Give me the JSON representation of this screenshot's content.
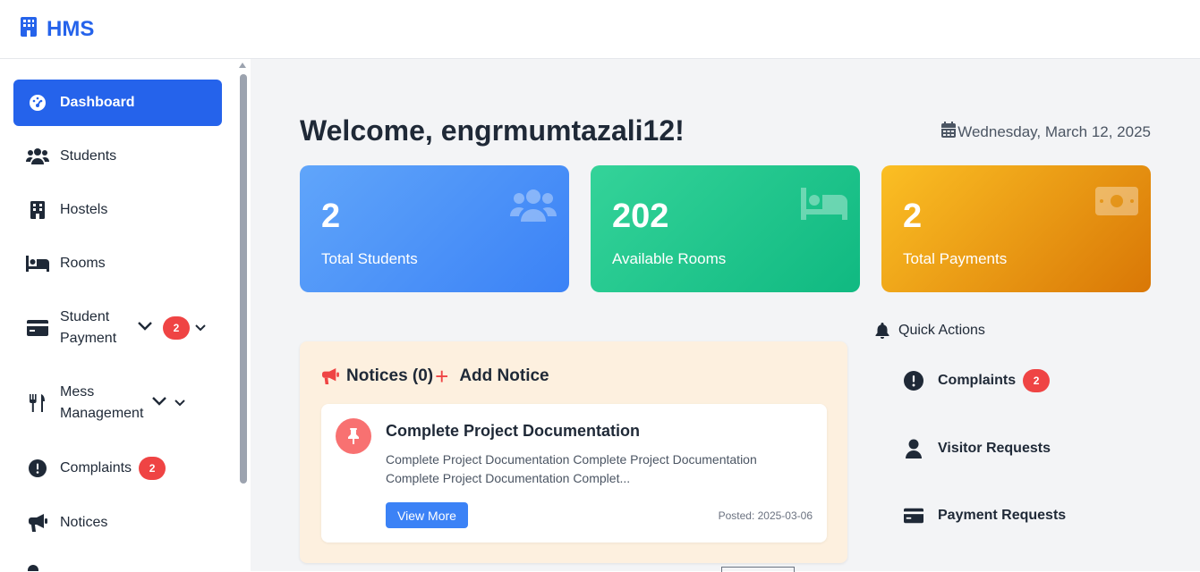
{
  "brand": {
    "name": "HMS",
    "color": "#2563eb"
  },
  "sidebar": {
    "items": [
      {
        "label": "Dashboard",
        "icon": "gauge-icon",
        "active": true
      },
      {
        "label": "Students",
        "icon": "users-icon"
      },
      {
        "label": "Hostels",
        "icon": "building-icon"
      },
      {
        "label": "Rooms",
        "icon": "bed-icon"
      },
      {
        "label": "Student Payment",
        "icon": "credit-card-icon",
        "badge": "2",
        "expandable": true
      },
      {
        "label": "Mess Management",
        "icon": "utensils-icon",
        "expandable": true
      },
      {
        "label": "Complaints",
        "icon": "exclamation-circle-icon",
        "badge": "2"
      },
      {
        "label": "Notices",
        "icon": "megaphone-icon"
      }
    ]
  },
  "header": {
    "welcome": "Welcome, engrmumtazali12!",
    "date": "Wednesday, March 12, 2025"
  },
  "stats": [
    {
      "value": "2",
      "label": "Total Students",
      "icon": "users-icon",
      "color": "#3b82f6"
    },
    {
      "value": "202",
      "label": "Available Rooms",
      "icon": "bed-icon",
      "color": "#10b981"
    },
    {
      "value": "2",
      "label": "Total Payments",
      "icon": "money-bill-icon",
      "color": "#d97706"
    }
  ],
  "notices": {
    "title": "Notices (0)",
    "add_label": "Add Notice",
    "items": [
      {
        "title": "Complete Project Documentation",
        "body": "Complete Project Documentation Complete Project Documentation Complete Project Documentation Complet...",
        "button": "View More",
        "posted": "Posted: 2025-03-06"
      }
    ]
  },
  "quick_actions": {
    "title": "Quick Actions",
    "items": [
      {
        "label": "Complaints",
        "icon": "exclamation-circle-icon",
        "badge": "2"
      },
      {
        "label": "Visitor Requests",
        "icon": "user-icon"
      },
      {
        "label": "Payment Requests",
        "icon": "credit-card-icon"
      }
    ]
  }
}
